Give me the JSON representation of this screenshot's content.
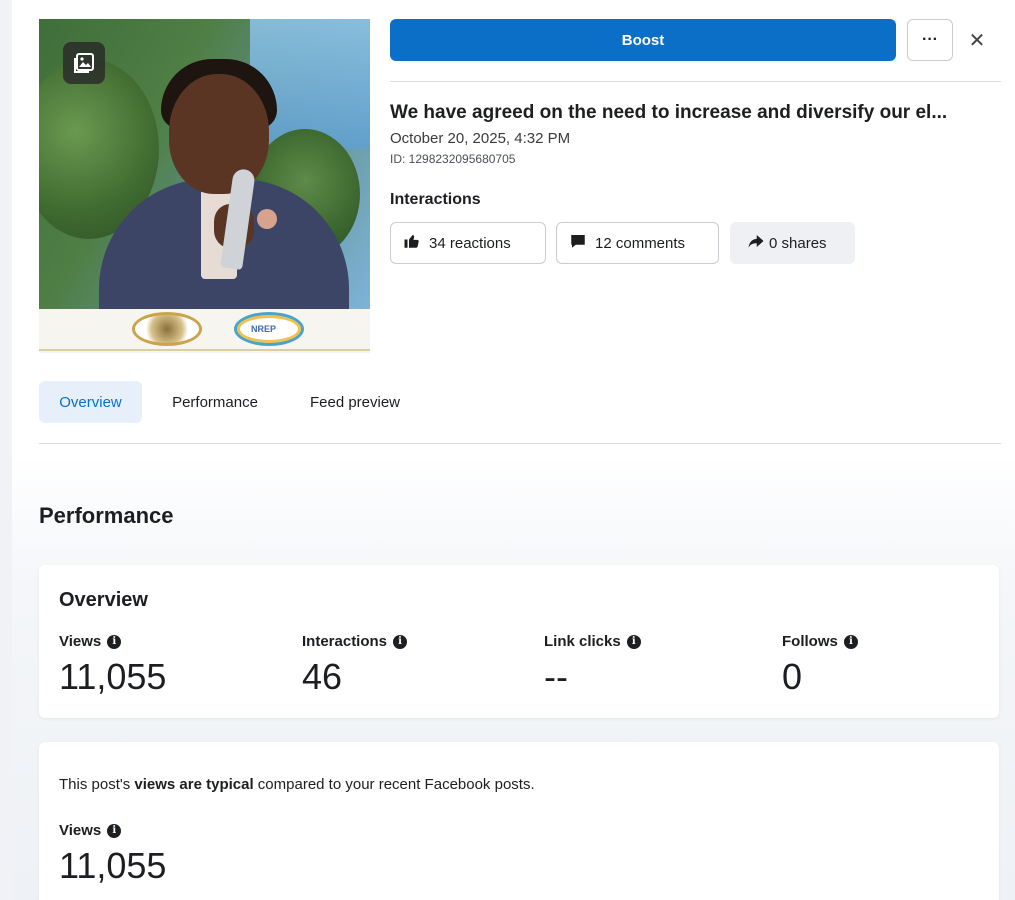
{
  "header": {
    "boost_label": "Boost",
    "more_label": "···",
    "close_label": "✕"
  },
  "post": {
    "title": "We have agreed on the need to increase and diversify our el...",
    "date": "October 20, 2025, 4:32 PM",
    "id": "ID: 1298232095680705",
    "thumbnail_logo_text": "NREP"
  },
  "interactions": {
    "label": "Interactions",
    "reactions": "34 reactions",
    "comments": "12 comments",
    "shares": "0 shares"
  },
  "tabs": [
    {
      "label": "Overview",
      "active": true
    },
    {
      "label": "Performance",
      "active": false
    },
    {
      "label": "Feed preview",
      "active": false
    }
  ],
  "performance": {
    "heading": "Performance",
    "overview": {
      "title": "Overview",
      "metrics": [
        {
          "label": "Views",
          "value": "11,055"
        },
        {
          "label": "Interactions",
          "value": "46"
        },
        {
          "label": "Link clicks",
          "value": "--"
        },
        {
          "label": "Follows",
          "value": "0"
        }
      ]
    },
    "typical": {
      "text_prefix": "This post's ",
      "text_bold": "views are typical",
      "text_suffix": " compared to your recent Facebook posts.",
      "metric_label": "Views",
      "metric_value": "11,055"
    }
  },
  "colors": {
    "accent": "#0b6fc7",
    "active_tab_bg": "#e7f0fa"
  },
  "icons": {
    "photo": "photo-album-icon",
    "reactions": "thumbs-up-icon",
    "comments": "comment-bubble-icon",
    "shares": "share-arrow-icon",
    "info": "info-icon",
    "close": "close-icon",
    "more": "more-options-icon"
  }
}
